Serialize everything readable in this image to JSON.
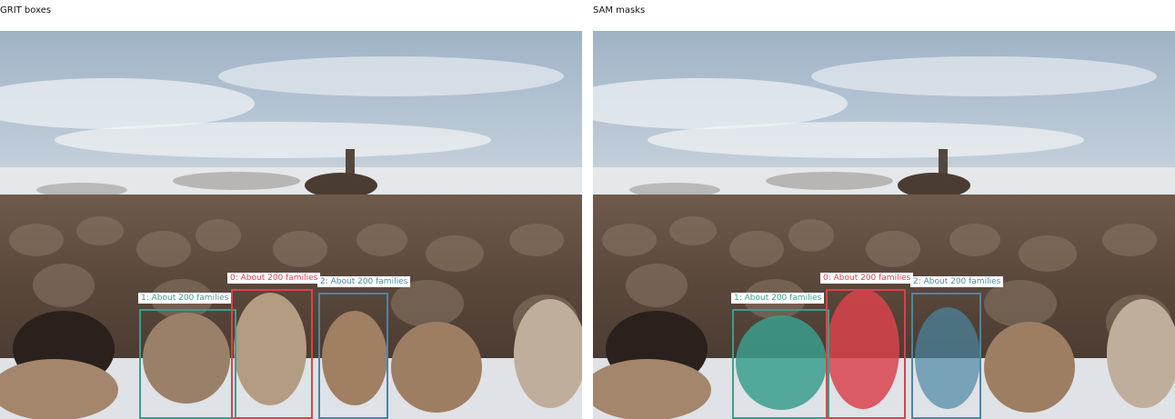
{
  "panels": [
    {
      "title": "GRIT boxes",
      "image_description": "herd of long-haired sheep and goats walking on snow toward a distant rider on horseback under a cloudy sky",
      "detections": [
        {
          "label": "0: About 200 families",
          "color": "#d9434b"
        },
        {
          "label": "1: About 200 families",
          "color": "#3a9e8c"
        },
        {
          "label": "2: About 200 families",
          "color": "#4a87a3"
        }
      ]
    },
    {
      "title": "SAM masks",
      "image_description": "same herd image with segmentation masks filled over three sheep",
      "detections": [
        {
          "label": "0: About 200 families",
          "color": "#d9434b"
        },
        {
          "label": "1: About 200 families",
          "color": "#3a9e8c"
        },
        {
          "label": "2: About 200 families",
          "color": "#4a87a3"
        }
      ]
    }
  ]
}
